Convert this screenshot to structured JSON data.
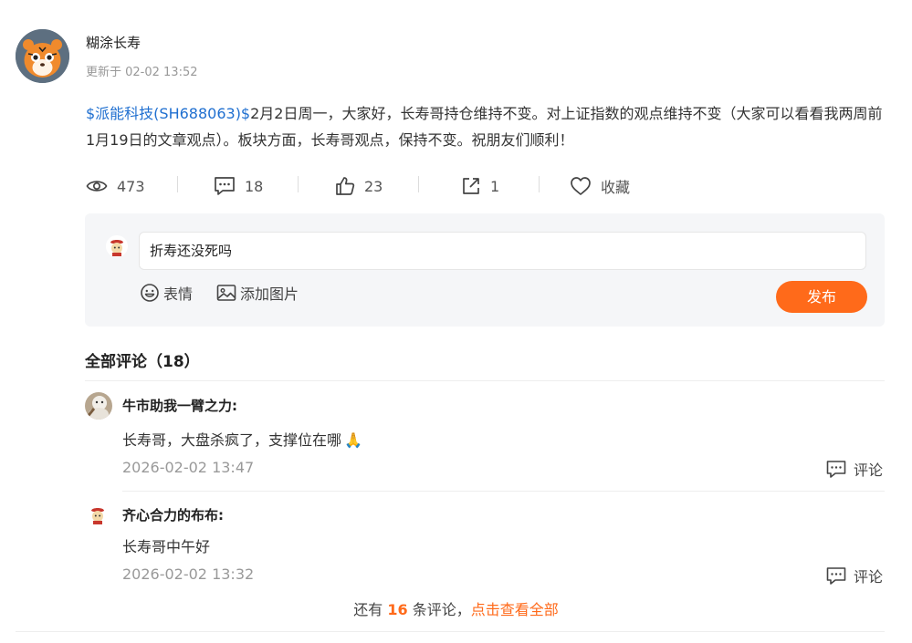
{
  "post": {
    "author": "糊涂长寿",
    "updated": "更新于 02-02 13:52",
    "stock_link": "$派能科技(SH688063)$",
    "body": "2月2日周一，大家好，长寿哥持仓维持不变。对上证指数的观点维持不变（大家可以看看我两周前1月19日的文章观点）。板块方面，长寿哥观点，保持不变。祝朋友们顺利！"
  },
  "stats": {
    "views": "473",
    "comments": "18",
    "likes": "23",
    "shares": "1",
    "favorite_label": "收藏"
  },
  "reply": {
    "input_value": "折寿还没死吗",
    "emoji_label": "表情",
    "image_label": "添加图片",
    "publish_label": "发布"
  },
  "comments_section": {
    "title": "全部评论（18）",
    "items": [
      {
        "author": "牛市助我一臂之力:",
        "text": "长寿哥，大盘杀疯了，支撑位在哪",
        "emoji": "🙏",
        "time": "2026-02-02 13:47",
        "reply_label": "评论"
      },
      {
        "author": "齐心合力的布布:",
        "text": "长寿哥中午好",
        "time": "2026-02-02 13:32",
        "reply_label": "评论"
      }
    ],
    "more_prefix": "还有",
    "more_count": "16",
    "more_suffix": "条评论，",
    "more_link": "点击查看全部"
  },
  "colors": {
    "accent": "#ff6a1a",
    "link": "#1f6fd0",
    "panel": "#f5f6f8"
  },
  "icons": [
    "eye-icon",
    "comment-icon",
    "thumbs-up-icon",
    "share-icon",
    "heart-icon",
    "emoji-icon",
    "image-icon",
    "reply-icon"
  ]
}
